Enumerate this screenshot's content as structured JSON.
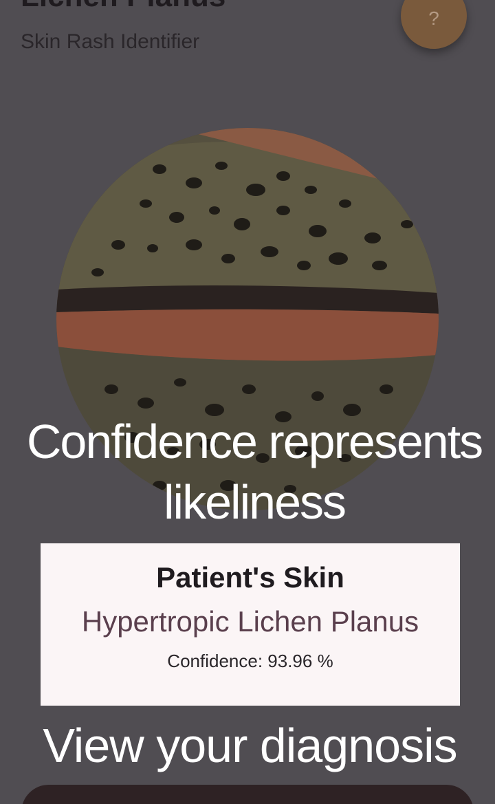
{
  "header": {
    "title": "Lichen Planus",
    "subtitle": "Skin Rash Identifier",
    "help_label": "?"
  },
  "tutorial": {
    "confidence_caption": "Confidence represents likeliness",
    "view_caption": "View your diagnosis"
  },
  "result": {
    "heading": "Patient's Skin",
    "diagnosis": "Hypertropic Lichen Planus",
    "confidence": "Confidence: 93.96 %"
  },
  "colors": {
    "overlay": "#504d52",
    "accent": "#7a5a3c",
    "card": "#fbf5f6",
    "diagnosis_text": "#5a3f4d"
  }
}
